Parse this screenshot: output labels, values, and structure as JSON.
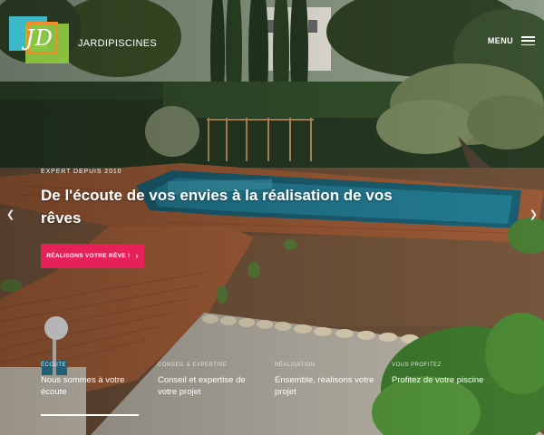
{
  "header": {
    "logo_letters": "JD",
    "brand": "JARDIPISCINES",
    "menu_label": "MENU",
    "menu_icon": "hamburger-icon"
  },
  "hero": {
    "eyebrow": "EXPERT DEPUIS 2010",
    "headline": "De l'écoute de vos envies à la réalisation de vos rêves",
    "cta_label": "RÉALISONS VOTRE RÊVE !",
    "cta_icon": "chevron-right-icon",
    "prev_icon": "chevron-left-icon",
    "next_icon": "chevron-right-icon"
  },
  "steps": [
    {
      "label": "ÉCOUTE",
      "title": "Nous sommes à votre écoute",
      "active": true
    },
    {
      "label": "CONSEIL & EXPERTISE",
      "title": "Conseil et expertise de votre projet",
      "active": false
    },
    {
      "label": "RÉALISATION",
      "title": "Ensemble, réalisons votre projet",
      "active": false
    },
    {
      "label": "VOUS PROFITEZ",
      "title": "Profitez de votre piscine",
      "active": false
    }
  ],
  "colors": {
    "accent": "#e6215a",
    "logo_teal": "#3cb8c8",
    "logo_green": "#8dc63f",
    "logo_orange": "#f28c28"
  }
}
